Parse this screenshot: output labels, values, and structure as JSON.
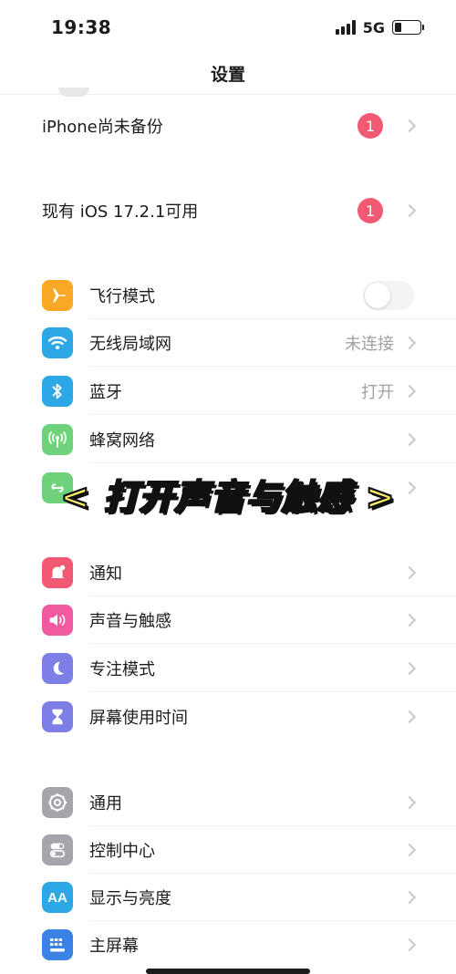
{
  "status_bar": {
    "time": "19:38",
    "network": "5G",
    "battery_percent": 25
  },
  "nav": {
    "title": "设置"
  },
  "alerts": [
    {
      "label": "iPhone尚未备份",
      "badge": "1"
    },
    {
      "label": "现有 iOS 17.2.1可用",
      "badge": "1"
    }
  ],
  "connectivity": [
    {
      "label": "飞行模式",
      "icon": "airplane-icon",
      "color": "#f9a826",
      "toggle_on": false
    },
    {
      "label": "无线局域网",
      "icon": "wifi-icon",
      "color": "#2ea7e6",
      "value": "未连接"
    },
    {
      "label": "蓝牙",
      "icon": "bluetooth-icon",
      "color": "#2ea7e6",
      "value": "打开"
    },
    {
      "label": "蜂窝网络",
      "icon": "cellular-icon",
      "color": "#6fd27a"
    },
    {
      "label": "",
      "icon": "hotspot-icon",
      "color": "#6fd27a"
    }
  ],
  "overlay": {
    "text": "< 打开声音与触感 >"
  },
  "notifications_group": [
    {
      "label": "通知",
      "icon": "bell-icon",
      "color": "#f25a73"
    },
    {
      "label": "声音与触感",
      "icon": "speaker-icon",
      "color": "#f25aa0"
    },
    {
      "label": "专注模式",
      "icon": "moon-icon",
      "color": "#7d7fe6"
    },
    {
      "label": "屏幕使用时间",
      "icon": "hourglass-icon",
      "color": "#7d7fe6"
    }
  ],
  "general_group": [
    {
      "label": "通用",
      "icon": "gear-icon",
      "color": "#a5a5ab"
    },
    {
      "label": "控制中心",
      "icon": "toggles-icon",
      "color": "#a5a5ab"
    },
    {
      "label": "显示与亮度",
      "icon": "text-size-icon",
      "color": "#2ea7e6",
      "icon_text": "AA"
    },
    {
      "label": "主屏幕",
      "icon": "home-grid-icon",
      "color": "#3b82e6"
    }
  ]
}
